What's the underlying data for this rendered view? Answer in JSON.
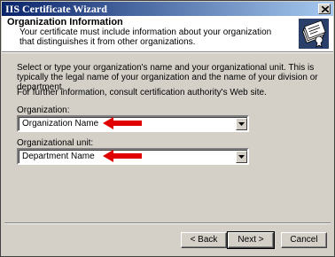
{
  "window": {
    "title": "IIS Certificate Wizard"
  },
  "header": {
    "title": "Organization Information",
    "description": "Your certificate must include information about your organization that distinguishes it from other organizations.",
    "icon": "certificate-wizard-icon"
  },
  "body": {
    "intro": "Select or type your organization's name and your organizational unit. This is typically the legal name of your organization and the name of your division or department.",
    "further_info": "For further information, consult certification authority's Web site.",
    "organization": {
      "label": "Organization:",
      "value": "Organization Name"
    },
    "organizational_unit": {
      "label": "Organizational unit:",
      "value": "Department Name"
    }
  },
  "buttons": {
    "back": "< Back",
    "next": "Next >",
    "cancel": "Cancel"
  },
  "colors": {
    "annotation_arrow": "#e00000",
    "titlebar": "#0a246a"
  }
}
